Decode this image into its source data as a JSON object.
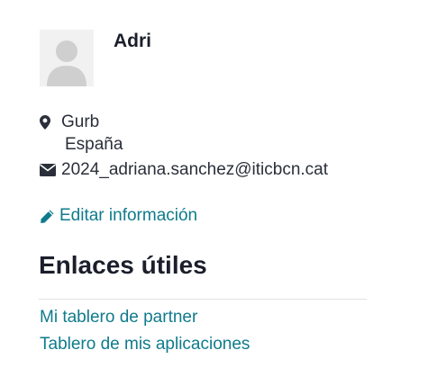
{
  "profile": {
    "name": "Adri",
    "avatar_icon": "user-silhouette-icon",
    "city": "Gurb",
    "country": "España",
    "email": "2024_adriana.sanchez@iticbcn.cat",
    "edit_label": "Editar información"
  },
  "useful_links": {
    "title": "Enlaces útiles",
    "items": [
      {
        "label": "Mi tablero de partner"
      },
      {
        "label": "Tablero de mis aplicaciones"
      }
    ]
  },
  "colors": {
    "link": "#0f7b8c",
    "text": "#1b1f2b",
    "divider": "#e2e2e2"
  }
}
